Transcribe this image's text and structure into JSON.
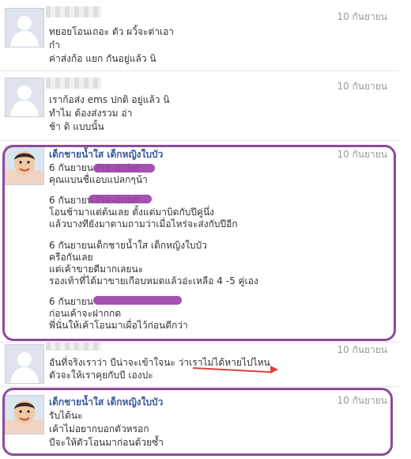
{
  "messages": [
    {
      "date": "10 กันยายน",
      "lines": [
        "ทยอยโอนเถอะ ตัว ผวิ้จะต่าเอา",
        "ก๋า",
        "ค่าส่งก้อ แยก กันอยู่แล้ว นิ"
      ]
    },
    {
      "date": "10 กันยายน",
      "lines": [
        "เราก้อส่ง ems ปกติ อยู่แล้ว นิ",
        "ทำไม ต้องส่งรวม อ่า",
        "ช้า ดิ แบบนั้น"
      ]
    },
    {
      "sender": "เด็กชายน้ำใส เด็กหญิงใบบัว",
      "date": "10 กันยายน",
      "lines": [
        "6 กันยายน Pre-order",
        "คุณแบนชื่แอบแปลกๆน้า",
        "6 กันยายน Pre-order",
        "โอนช้ามาแต่ต้นเลย ตั้งแต่มาบิดกับปีคู่นึ่ง",
        "แล้วบางทียังมาตามถามว่าเมื่อไหร่จะส่งกับปีอีก",
        "6 กันยายนเด็กชายน้ำใส เด็กหญิงใบบัว",
        "ครือกันเลย",
        "แต่เค้าขายดีมากเลยนะ",
        "รองเท้าที่ได้มาขายเกือบหมดแล้วอ่ะเหลือ 4 -5 คู่เอง",
        "6 กันยายน",
        "ก่อนเค้าจะฝากกด",
        "พี่นั่นให้เค้าโอนมาเผื่อไว้ก่อนดีกว่า"
      ]
    },
    {
      "date": "10 กันยายน",
      "lines": [
        "อันที่จริงเราว่า บีน่าจะเข้าใจนะ ว่าเราไม่ได้หายไปไหน",
        "ตัวจะให้เราคุยกับบี เองปะ"
      ]
    },
    {
      "sender": "เด็กชายน้ำใส เด็กหญิงใบบัว",
      "date": "10 กันยายน",
      "lines": [
        "รับได้นะ",
        "เค้าไม่อยากบอกตัวหรอก",
        "บีจะให้ตัวโอนมาก่อนด้วยซ้ำ"
      ]
    }
  ],
  "colors": {
    "highlight": "#8e4a9c",
    "arrow": "#e0413a",
    "sender": "#3b5998"
  }
}
